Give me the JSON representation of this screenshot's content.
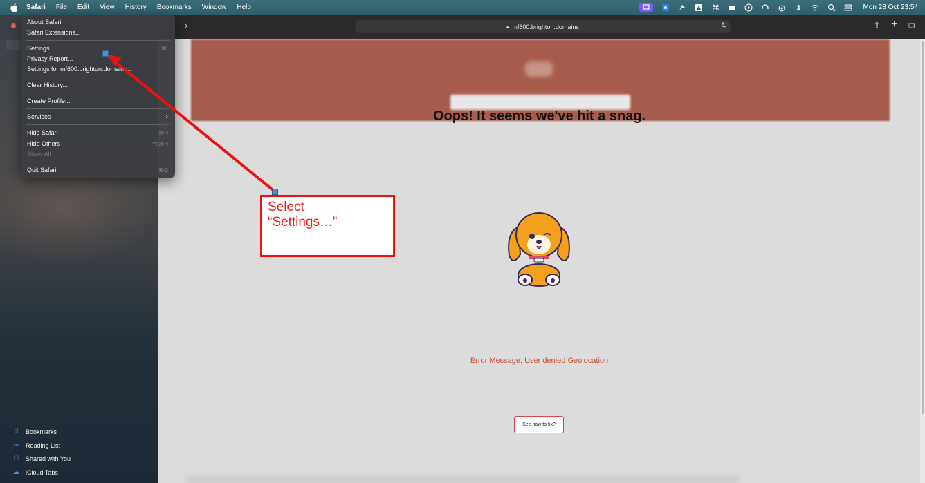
{
  "menubar": {
    "items": [
      "Safari",
      "File",
      "Edit",
      "View",
      "History",
      "Bookmarks",
      "Window",
      "Help"
    ],
    "clock": "Mon 28 Oct  23:54"
  },
  "toolbar": {
    "url": "mf600.brighton.domains"
  },
  "safari_menu": {
    "items": [
      {
        "label": "About Safari",
        "shortcut": ""
      },
      {
        "label": "Safari Extensions...",
        "shortcut": ""
      },
      {
        "label": "Settings...",
        "shortcut": "⌘,"
      },
      {
        "label": "Privacy Report...",
        "shortcut": ""
      },
      {
        "label": "Settings for mf600.brighton.domains...",
        "shortcut": ""
      },
      {
        "label": "Clear History...",
        "shortcut": ""
      },
      {
        "label": "Create Profile...",
        "shortcut": ""
      },
      {
        "label": "Services",
        "shortcut": "›"
      },
      {
        "label": "Hide Safari",
        "shortcut": "⌘H"
      },
      {
        "label": "Hide Others",
        "shortcut": "⌥⌘H"
      },
      {
        "label": "Show All",
        "shortcut": ""
      },
      {
        "label": "Quit Safari",
        "shortcut": "⌘Q"
      }
    ]
  },
  "sidebar": {
    "items": [
      {
        "label": "Bookmarks",
        "icon": "bookmark-icon"
      },
      {
        "label": "Reading List",
        "icon": "glasses-icon"
      },
      {
        "label": "Shared with You",
        "icon": "people-icon"
      },
      {
        "label": "iCloud Tabs",
        "icon": "cloud-icon"
      }
    ]
  },
  "page": {
    "heading": "Oops! It seems we've hit a snag.",
    "error": "Error Message: User denied Geolocation",
    "fix_button": "See how to fix?"
  },
  "annotation": {
    "text": "Select\n“Settings…”"
  },
  "colors": {
    "accent": "#e8231c",
    "banner": "#a85c4c",
    "error_text": "#d24a2a"
  }
}
